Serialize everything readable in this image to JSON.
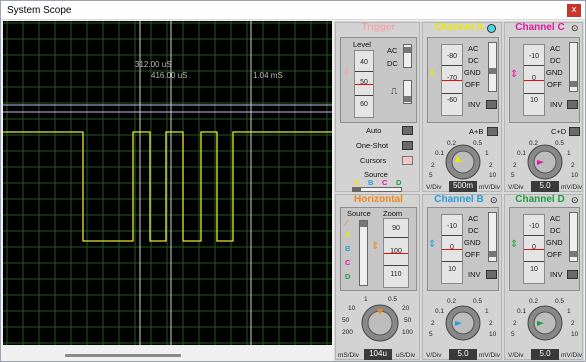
{
  "window": {
    "title": "System Scope",
    "close": "x"
  },
  "cursors": {
    "c1": "312.00 uS",
    "c2": "416.00 uS",
    "c3": "1.04 mS"
  },
  "trigger": {
    "title": "Trigger",
    "level_label": "Level",
    "level_scale": [
      "40",
      "50",
      "60"
    ],
    "ac": "AC",
    "dc": "DC",
    "auto": "Auto",
    "oneshot": "One-Shot",
    "cursors": "Cursors",
    "source_label": "Source",
    "source_letters": [
      "A",
      "B",
      "C",
      "D"
    ]
  },
  "channel_a": {
    "title": "Channel A",
    "scale": [
      "-80",
      "-70",
      "-60"
    ],
    "opts": [
      "AC",
      "DC",
      "GND",
      "OFF"
    ],
    "inv": "INV",
    "combo": "A+B",
    "dial": [
      "0.5",
      "1",
      "2",
      "5",
      "10",
      "20",
      "50",
      "100",
      "200",
      "0.5",
      "1",
      "2",
      "5",
      "10",
      "20"
    ],
    "readout": "500m",
    "unit_left": "V/Div",
    "unit_right": "mV/Div"
  },
  "channel_c": {
    "title": "Channel C",
    "scale": [
      "-10",
      "0",
      "10"
    ],
    "opts": [
      "AC",
      "DC",
      "GND",
      "OFF"
    ],
    "inv": "INV",
    "combo": "C+D",
    "dial": [
      "0.5",
      "1",
      "2",
      "5",
      "10",
      "20",
      "50",
      "100",
      "200",
      "0.5",
      "1",
      "2",
      "5",
      "10",
      "20"
    ],
    "readout": "5.0",
    "unit_left": "V/Div",
    "unit_right": "mV/Div"
  },
  "horizontal": {
    "title": "Horizontal",
    "source_label": "Source",
    "zoom_label": "Zoom",
    "source_letters": [
      "A",
      "B",
      "C",
      "D"
    ],
    "zoom_scale": [
      "90",
      "100",
      "110"
    ],
    "dial": [
      "0.5",
      "1",
      "2",
      "5",
      "10",
      "20",
      "50",
      "100",
      "200",
      "0.5",
      "1",
      "2",
      "5",
      "10",
      "20",
      "50",
      "100",
      "200"
    ],
    "readout": "104u",
    "unit_left": "mS/Div",
    "unit_right": "uS/Div"
  },
  "channel_b": {
    "title": "Channel B",
    "scale": [
      "-10",
      "0",
      "10"
    ],
    "opts": [
      "AC",
      "DC",
      "GND",
      "OFF"
    ],
    "inv": "INV",
    "dial": [
      "0.5",
      "1",
      "2",
      "5",
      "10",
      "20",
      "50",
      "100",
      "200",
      "0.5",
      "1",
      "2",
      "5",
      "10",
      "20"
    ],
    "readout": "5.0",
    "unit_left": "V/Div",
    "unit_right": "mV/Div"
  },
  "channel_d": {
    "title": "Channel D",
    "scale": [
      "-10",
      "0",
      "10"
    ],
    "opts": [
      "AC",
      "DC",
      "GND",
      "OFF"
    ],
    "inv": "INV",
    "dial": [
      "0.5",
      "1",
      "2",
      "5",
      "10",
      "20",
      "50",
      "100",
      "200",
      "0.5",
      "1",
      "2",
      "5",
      "10",
      "20"
    ],
    "readout": "5.0",
    "unit_left": "V/Div",
    "unit_right": "mV/Div"
  },
  "colors": {
    "trigger": "#f2a8a8",
    "channel_a": "#e8e800",
    "channel_b": "#2a9ed8",
    "channel_c": "#e01aa0",
    "channel_d": "#20a040",
    "horizontal": "#f08a1a",
    "trace": "#e6e632",
    "grid": "#1f5a1f",
    "screen": "#000000"
  },
  "icons": {
    "channel_a_status": "cyan-dot-icon",
    "settings": "gear-icon"
  }
}
